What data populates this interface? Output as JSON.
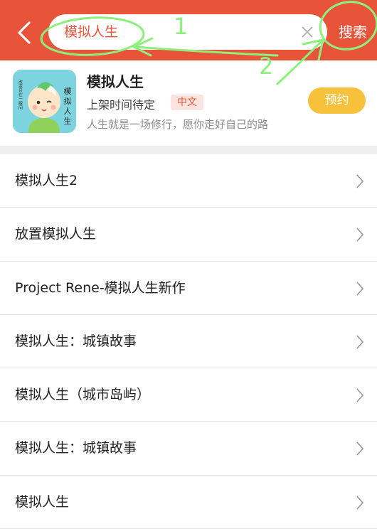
{
  "search": {
    "query": "模拟人生",
    "button_label": "搜索"
  },
  "annotations": {
    "mark_1": "1",
    "mark_2": "2"
  },
  "app": {
    "name": "模拟人生",
    "release_status": "上架时间待定",
    "language_tag": "中文",
    "description": "人生就是一场修行，愿你走好自己的路",
    "reserve_label": "预约",
    "icon_text_vertical": [
      "模",
      "拟",
      "人",
      "生"
    ],
    "icon_text_small": "改变只在一瞬间"
  },
  "suggestions": [
    "模拟人生2",
    "放置模拟人生",
    "Project Rene-模拟人生新作",
    "模拟人生：城镇故事",
    "模拟人生（城市岛屿）",
    "模拟人生：城镇故事",
    "模拟人生"
  ],
  "colors": {
    "header": "#e8543a",
    "accent": "#e8543a",
    "reserve": "#f8c13c",
    "annotation": "#8cf07c"
  }
}
